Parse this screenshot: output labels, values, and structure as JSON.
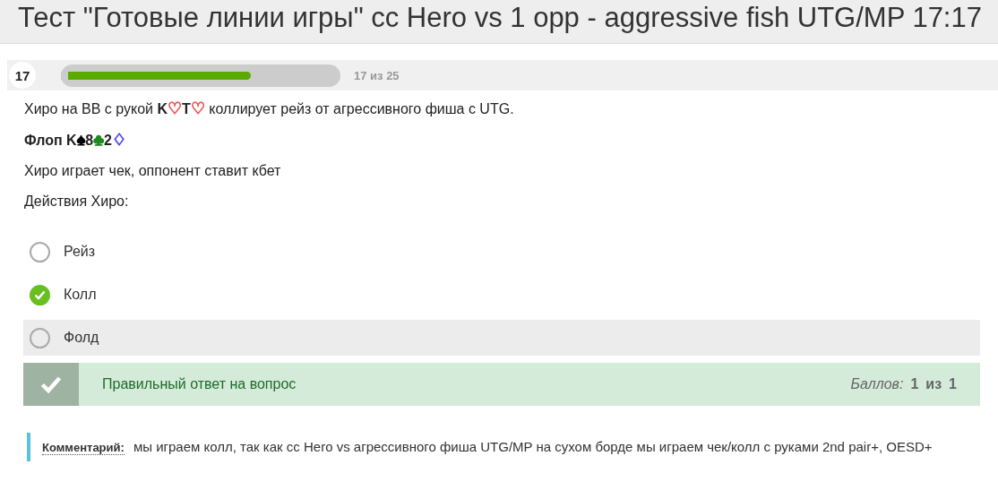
{
  "window": {
    "title": "Тест \"Готовые линии игры\" сс Hero vs 1 opp - aggressive fish UTG/MP 17:17"
  },
  "progress": {
    "number": "17",
    "level": 0.68,
    "count": "17 из 25"
  },
  "question": [
    {
      "parts": [
        {
          "kind": "plain",
          "text": "Хиро на BB с рукой "
        },
        {
          "kind": "bold",
          "text": "K"
        },
        {
          "kind": "suit",
          "text": "♡",
          "color": "#f06060"
        },
        {
          "kind": "bold",
          "text": "T"
        },
        {
          "kind": "suit",
          "text": "♡",
          "color": "#f06060"
        },
        {
          "kind": "plain",
          "text": " коллирует рейз от агрессивного фиша с UTG."
        }
      ]
    },
    {
      "parts": [
        {
          "kind": "bold",
          "text": "Флоп K"
        },
        {
          "kind": "suit",
          "text": "♠",
          "color": "#000000"
        },
        {
          "kind": "bold",
          "text": "8"
        },
        {
          "kind": "suit",
          "text": "♣",
          "color": "#1e8a1e"
        },
        {
          "kind": "bold",
          "text": "2"
        },
        {
          "kind": "suit",
          "text": "♢",
          "color": "#4a4aff"
        }
      ]
    },
    {
      "parts": [
        {
          "kind": "plain",
          "text": "Хиро играет чек, оппонент ставит кбет"
        }
      ]
    },
    {
      "parts": [
        {
          "kind": "plain",
          "text": "Действия Хиро:"
        }
      ]
    }
  ],
  "options": [
    {
      "label": "Рейз",
      "selected": false,
      "highlighted": false
    },
    {
      "label": "Колл",
      "selected": true,
      "highlighted": false
    },
    {
      "label": "Фолд",
      "selected": false,
      "highlighted": true
    }
  ],
  "feedback": {
    "kind": "correct",
    "message": "Правильный ответ на вопрос",
    "score_label": "Баллов:",
    "score": "1",
    "of": "из",
    "max": "1"
  },
  "comment": {
    "label": "Комментарий:",
    "text": "мы играем колл, так как сс Hero vs агрессивного фиша  UTG/MP на сухом борде мы играем чек/колл с руками 2nd pair+, OESD+"
  }
}
